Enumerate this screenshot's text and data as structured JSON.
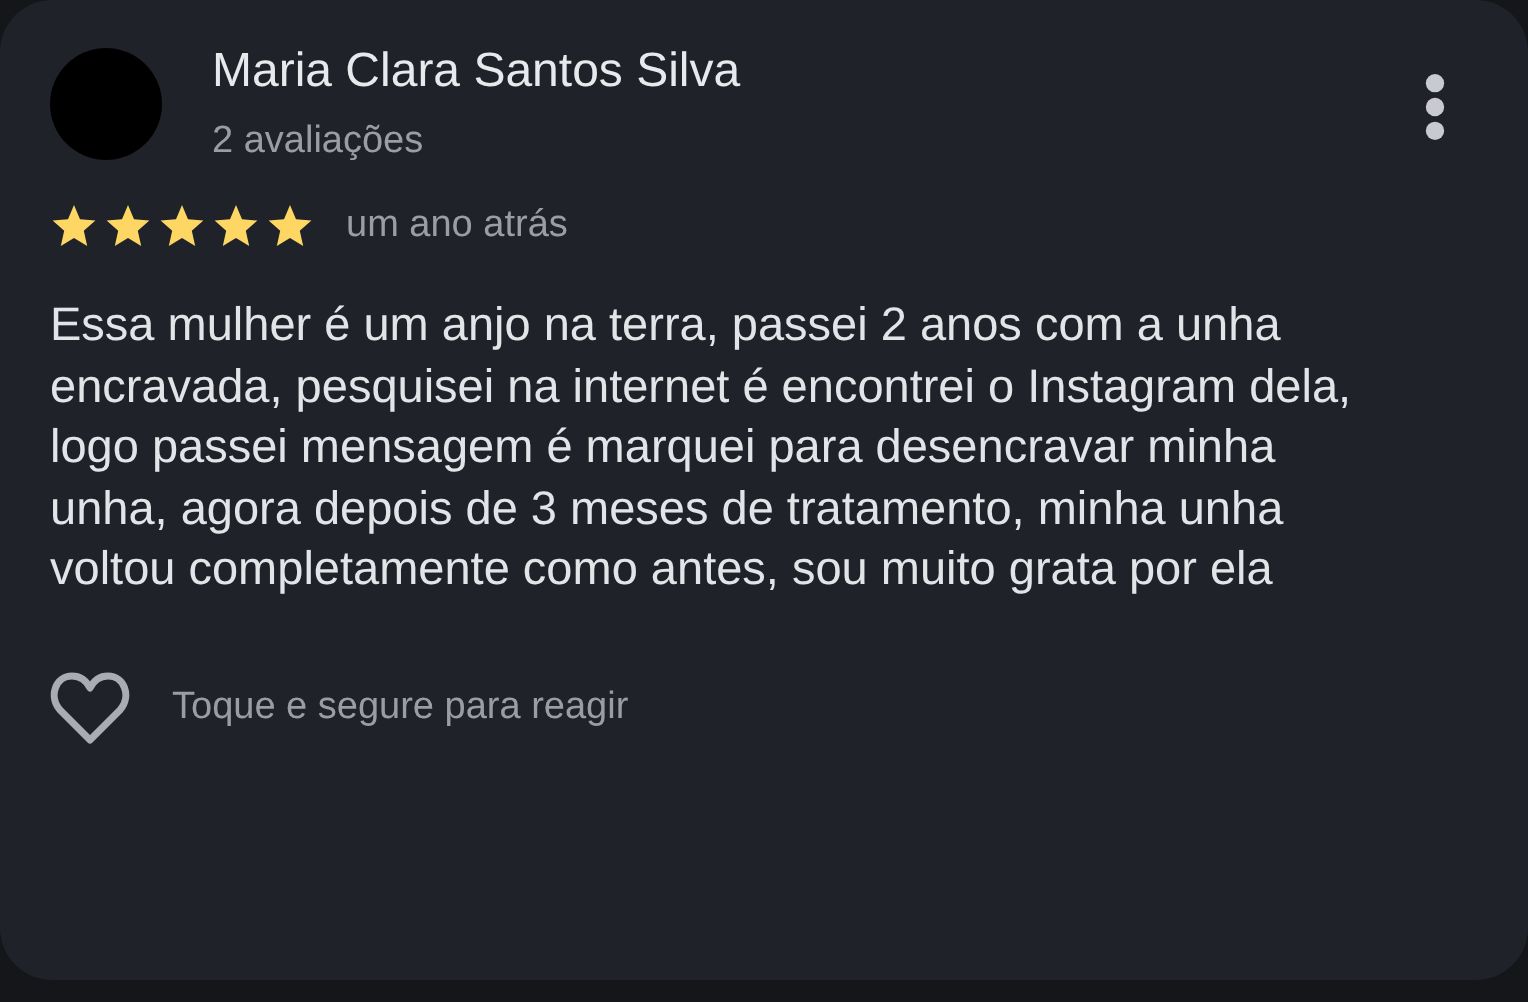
{
  "review": {
    "author": "Maria Clara Santos Silva",
    "review_count": "2 avaliações",
    "stars": 5,
    "time": "um ano atrás",
    "text": "Essa mulher é um anjo na terra, passei 2 anos com a unha encravada, pesquisei na internet é encontrei o Instagram dela, logo passei mensagem é marquei para desencravar minha unha, agora depois de 3 meses de tratamento, minha unha voltou completamente como antes, sou muito grata por ela",
    "reaction_hint": "Toque e segure para reagir"
  }
}
